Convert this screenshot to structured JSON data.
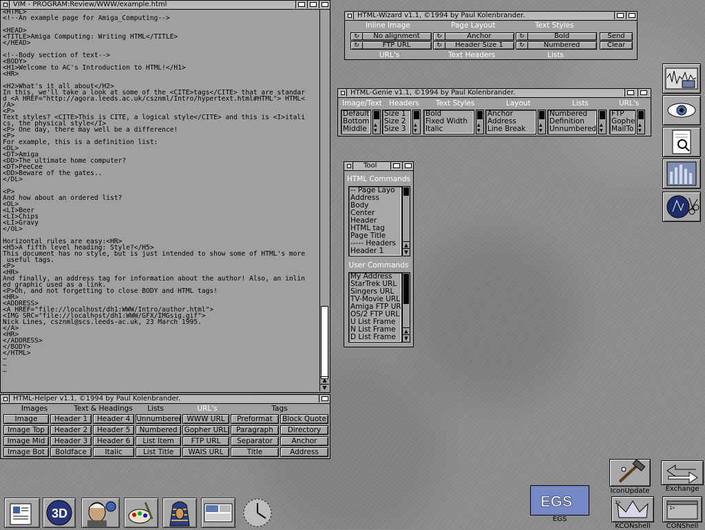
{
  "vim": {
    "title": "VIM - PROGRAM:Review/WWW/example.html",
    "lines": [
      "<HTML>",
      "<!--An example page for Amiga_Computing-->",
      "",
      "<HEAD>",
      "<TITLE>Amiga Computing: Writing HTML</TITLE>",
      "</HEAD>",
      "",
      "<!--Body section of text-->",
      "<BODY>",
      "<H1>Welcome to AC's Introduction to HTML!</H1>",
      "<HR>",
      "",
      "<H2>What's it all about</H2>",
      "In this, we'll take a look at some of the <CITE>tags</CITE> that are standar",
      "d <A HREF=\"http://agora.leeds.ac.uk/csznml/Intro/hypertext.html#HTML\"> HTML<",
      "/A>",
      "<P>",
      "Text styles? <CITE>This is CITE, a logical style</CITE> and this is <I>itali",
      "cs, the physical style</I>",
      "<P> One day, there may well be a difference!",
      "<P>",
      "For example, this is a definition list:",
      "<DL>",
      "<DT>Amiga",
      "<DD>The ultimate home computer?",
      "<DT>PeeCee",
      "<DD>Beware of the gates..",
      "</DL>",
      "",
      "<P>",
      "And how about an ordered list?",
      "<OL>",
      "<LI>Beer",
      "<LI>Chips",
      "<LI>Gravy",
      "</OL>",
      "",
      "Horizontal rules are easy:<HR>",
      "<H5>A fifth level heading: Style?</H5>",
      "This document has no style, but is just intended to show some of HTML's more",
      " useful tags.",
      "<P>",
      "<HR>",
      "And finally, an address tag for information about the author! Also, an inlin",
      "ed graphic used as a link.",
      "<P>Oh, and not forgetting to close BODY and HTML tags!",
      "<HR>",
      "<ADDRESS>",
      "<A HREF=\"file://localhost/dh1:WWW/Intro/author.html\">",
      "<IMG SRC=\"file://localhost/dh1:WWW/GFX/IMGsig.gif\">",
      "Nick Lines, csznml@scs.leeds-ac.uk, 23 March 1995.",
      "</A>",
      "<HR>",
      "</ADDRESS>",
      "</BODY>",
      "</HTML>",
      "~",
      "~",
      "~"
    ]
  },
  "helper": {
    "title": "HTML-Helper v1.1, ©1994 by Paul Kolenbrander.",
    "headers": [
      "Images",
      "Text & Headings",
      "Lists",
      "URL's",
      "Tags"
    ],
    "rows": [
      [
        "Image",
        "Header 1",
        "Header 4",
        "Unnumbered",
        "WWW  URL",
        "Preformat",
        "Block Quote"
      ],
      [
        "Image Top",
        "Header 2",
        "Header 5",
        "Numbered",
        "Gopher URL",
        "Paragraph",
        "Directory"
      ],
      [
        "Image Mid",
        "Header 3",
        "Header 6",
        "List Item",
        "FTP  URL",
        "Separator",
        "Anchor"
      ],
      [
        "Image Bot",
        "Boldface",
        "Italic",
        "List Title",
        "WAIS  URL",
        "Title",
        "Address"
      ]
    ]
  },
  "wizard": {
    "title": "HTML-Wizard v1.1, ©1994 by Paul Kolenbrander.",
    "top_labels": [
      "Inline Image",
      "Page Layout",
      "Text Styles"
    ],
    "bottom_labels": [
      "URL's",
      "Text Headers",
      "Lists"
    ],
    "row1": [
      "No alignment",
      "Anchor",
      "Bold"
    ],
    "row2": [
      "FTP      URL",
      "Header Size 1",
      "Numbered"
    ],
    "send": "Send",
    "clear": "Clear"
  },
  "genie": {
    "title": "HTML-Genie v1.1, ©1994 by Paul Kolenbrander.",
    "labels": [
      "Image/Text",
      "Headers",
      "Text Styles",
      "Layout",
      "Lists",
      "URL's"
    ],
    "image_text": [
      "Default",
      "Bottom",
      "Middle"
    ],
    "headers": [
      "Size 1",
      "Size 2",
      "Size 3"
    ],
    "text_styles": [
      "Bold",
      "Fixed Width",
      "Italic"
    ],
    "layout": [
      "Anchor",
      "Address",
      "Line Break"
    ],
    "lists": [
      "Numbered",
      "Definition",
      "Unnumbered"
    ],
    "urls": [
      "FTP",
      "Gophe",
      "MailTo"
    ]
  },
  "tool": {
    "title": "Tool",
    "html_commands_title": "HTML Commands",
    "html_commands": [
      "-- Page Layo",
      "Address",
      "Body",
      "Center",
      "Header",
      "HTML tag",
      "Page Title",
      "----- Headers",
      "Header 1"
    ],
    "user_commands_title": "User Commands",
    "user_commands": [
      "My Address",
      "StarTrek URL",
      "Singers URL",
      "TV-Movie URL",
      "Amiga FTP UR",
      "OS/2 FTP URL",
      "U List Frame",
      "N List Frame",
      "D List Frame"
    ]
  },
  "desktop_icons": {
    "egs": "EGS",
    "iconupdate": "IconUpdate",
    "exchange": "Exchange",
    "kconshell": "KCONshell",
    "conshell": "CONShell"
  }
}
